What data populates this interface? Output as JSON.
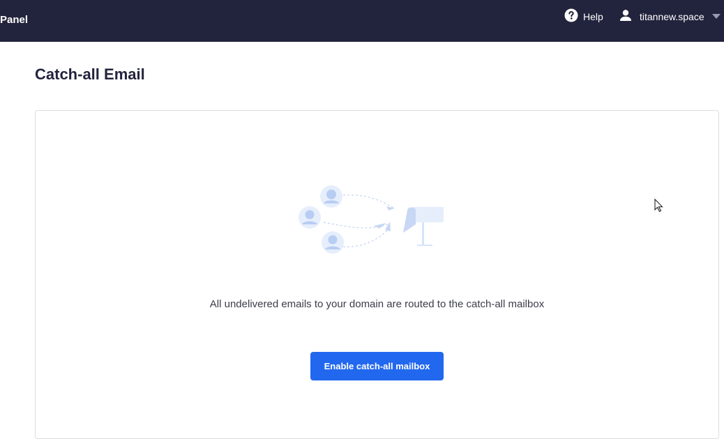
{
  "header": {
    "brand": "Panel",
    "help_label": "Help",
    "help_icon": "question-circle-icon",
    "user_label": "titannew.space",
    "user_icon": "person-icon",
    "caret_icon": "caret-down-icon"
  },
  "page": {
    "title": "Catch-all Email"
  },
  "empty_state": {
    "illustration": "catch-all-mailbox-illustration",
    "description": "All undelivered emails to your domain are routed to the catch-all mailbox",
    "button_label": "Enable catch-all mailbox"
  },
  "colors": {
    "topbar": "#22243d",
    "primary": "#2268ef",
    "illustration": "#d6e4fb"
  }
}
